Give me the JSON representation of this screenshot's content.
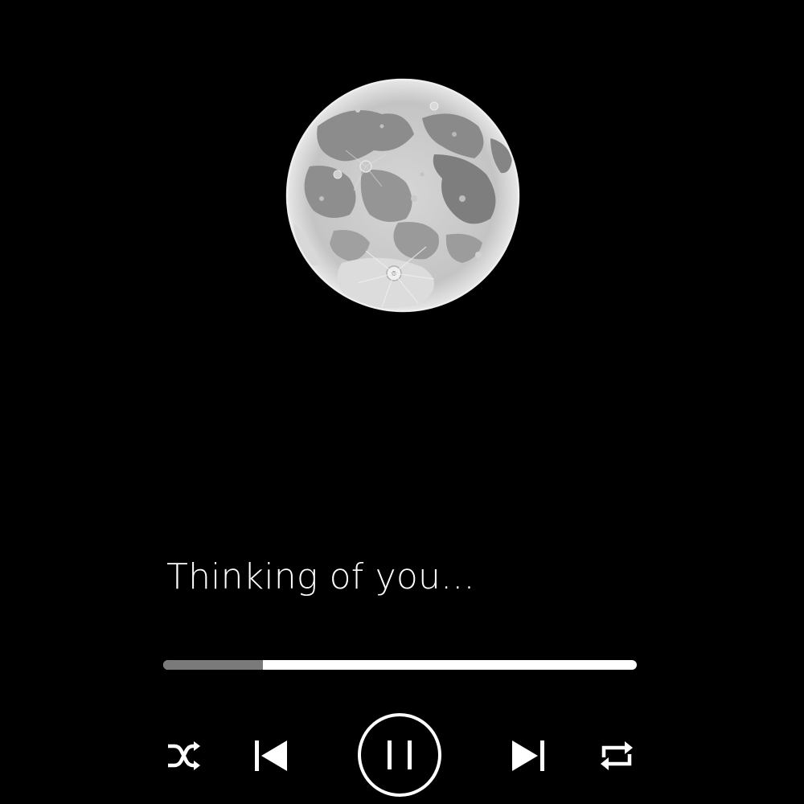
{
  "track": {
    "title": "Thinking of you...",
    "artwork_icon": "full-moon-artwork"
  },
  "playback": {
    "progress_fraction": 0.21,
    "state": "playing"
  },
  "controls": {
    "shuffle_icon": "shuffle-icon",
    "previous_icon": "skip-previous-icon",
    "play_pause_icon": "pause-icon",
    "next_icon": "skip-next-icon",
    "repeat_icon": "repeat-icon"
  },
  "colors": {
    "background": "#000000",
    "foreground": "#ffffff",
    "progress_fill": "#7a7a7a"
  }
}
